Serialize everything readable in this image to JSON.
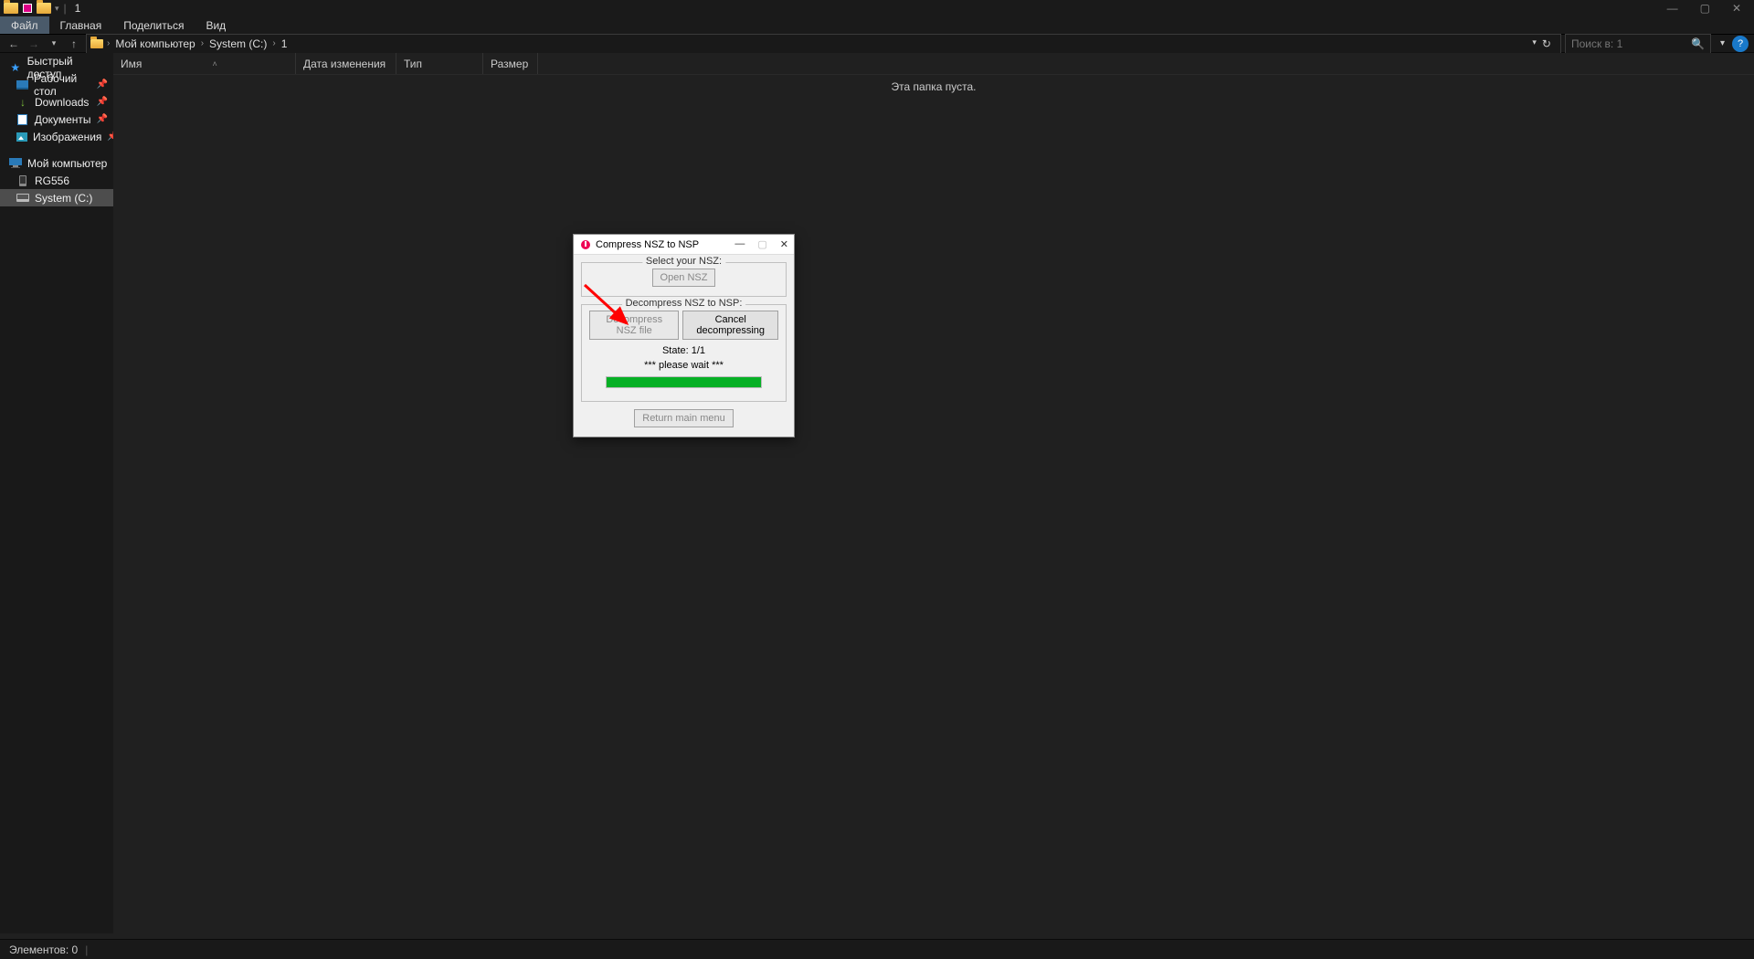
{
  "titlebar": {
    "title": "1"
  },
  "ribbon": {
    "file": "Файл",
    "main": "Главная",
    "share": "Поделиться",
    "view": "Вид"
  },
  "breadcrumb": {
    "root": "Мой компьютер",
    "drive": "System (C:)",
    "folder": "1"
  },
  "search": {
    "placeholder": "Поиск в: 1"
  },
  "sidebar": {
    "quick": "Быстрый доступ",
    "desktop": "Рабочий стол",
    "downloads": "Downloads",
    "documents": "Документы",
    "pictures": "Изображения",
    "mypc": "Мой компьютер",
    "rg556": "RG556",
    "systemc": "System (C:)"
  },
  "columns": {
    "name": "Имя",
    "date": "Дата изменения",
    "type": "Тип",
    "size": "Размер"
  },
  "empty_text": "Эта папка пуста.",
  "status": {
    "items": "Элементов: 0"
  },
  "dialog": {
    "title": "Compress NSZ to NSP",
    "select_legend": "Select your NSZ:",
    "open_btn": "Open NSZ",
    "decomp_legend": "Decompress NSZ to NSP:",
    "decomp_btn": "Decompress NSZ file",
    "cancel_btn": "Cancel decompressing",
    "state": "State: 1/1",
    "wait": "*** please wait ***",
    "return_btn": "Return main menu"
  }
}
